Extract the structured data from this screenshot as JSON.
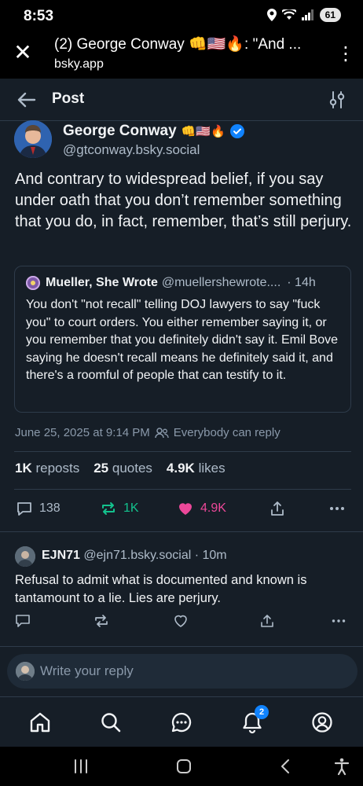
{
  "status_bar": {
    "time": "8:53",
    "battery": "61"
  },
  "browser": {
    "title": "(2) George Conway 👊🇺🇸🔥: \"And ...",
    "url": "bsky.app"
  },
  "header": {
    "title": "Post"
  },
  "post": {
    "author_name": "George Conway",
    "author_emojis": "👊🇺🇸🔥",
    "author_handle": "@gtconway.bsky.social",
    "text": "And contrary to widespread belief, if you say under oath that you don’t remember something that you do, in fact, remember, that’s still perjury.",
    "timestamp": "June 25, 2025 at 9:14 PM",
    "reply_setting": "Everybody can reply",
    "reposts_count": "1K",
    "reposts_label": "reposts",
    "quotes_count": "25",
    "quotes_label": "quotes",
    "likes_count": "4.9K",
    "likes_label": "likes",
    "actions": {
      "replies": "138",
      "reposts": "1K",
      "likes": "4.9K"
    }
  },
  "quote": {
    "author_name": "Mueller, She Wrote",
    "author_handle": "@muellershewrote....",
    "time": "· 14h",
    "text": "You don't \"not recall\" telling DOJ lawyers to say \"fuck you\" to court orders. You either remember saying it, or you remember that you definitely didn't say it. Emil Bove saying he doesn't recall means he definitely said it, and there's a roomful of people that can testify to it."
  },
  "reply": {
    "author_name": "EJN71",
    "author_handle": "@ejn71.bsky.social",
    "time": "· 10m",
    "text": "Refusal to admit what is documented and known is tantamount to a lie. Lies are perjury."
  },
  "composer": {
    "placeholder": "Write your reply"
  },
  "nav": {
    "notifications_badge": "2"
  },
  "colors": {
    "background": "#161e27",
    "accent": "#1083fe",
    "repost_active": "#13c28d",
    "like_active": "#ec4899"
  }
}
